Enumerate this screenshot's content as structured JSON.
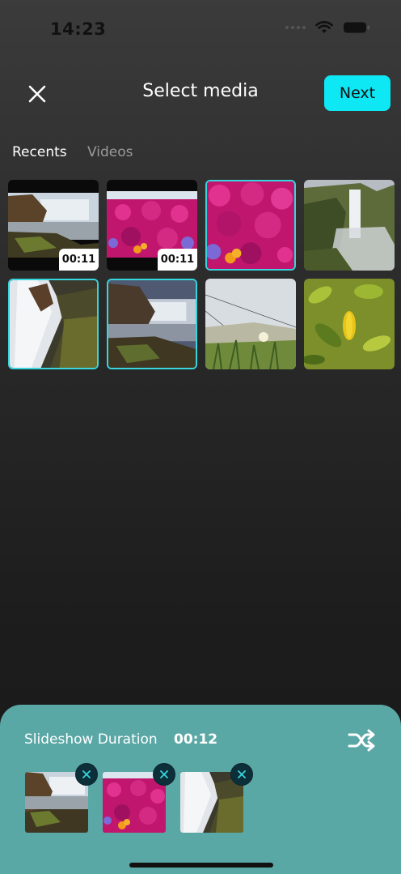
{
  "status_bar": {
    "time": "14:23"
  },
  "header": {
    "title": "Select media",
    "next_label": "Next",
    "close_icon": "close-icon"
  },
  "tabs": [
    {
      "label": "Recents",
      "active": true
    },
    {
      "label": "Videos",
      "active": false
    }
  ],
  "media": [
    {
      "kind": "video",
      "scene": "waterfall-coast",
      "duration": "00:11",
      "selected": false
    },
    {
      "kind": "video",
      "scene": "pink-flowers",
      "duration": "00:11",
      "selected": false
    },
    {
      "kind": "photo",
      "scene": "pink-flowers-closeup",
      "selected": true
    },
    {
      "kind": "photo",
      "scene": "waterfall-cliff",
      "selected": false
    },
    {
      "kind": "photo",
      "scene": "waterfall-rocks",
      "selected": true
    },
    {
      "kind": "photo",
      "scene": "waterfall-coast",
      "selected": true
    },
    {
      "kind": "photo",
      "scene": "grass-dune",
      "selected": false
    },
    {
      "kind": "photo",
      "scene": "green-leaves",
      "selected": false
    }
  ],
  "slideshow": {
    "label": "Slideshow Duration",
    "duration": "00:12",
    "shuffle_icon": "shuffle-icon",
    "selected_items": [
      {
        "scene": "waterfall-coast"
      },
      {
        "scene": "pink-flowers"
      },
      {
        "scene": "waterfall-rocks"
      }
    ]
  },
  "colors": {
    "accent": "#0ee8f4",
    "sheet": "#5aa8a6",
    "selection_border": "#37d5dd"
  }
}
